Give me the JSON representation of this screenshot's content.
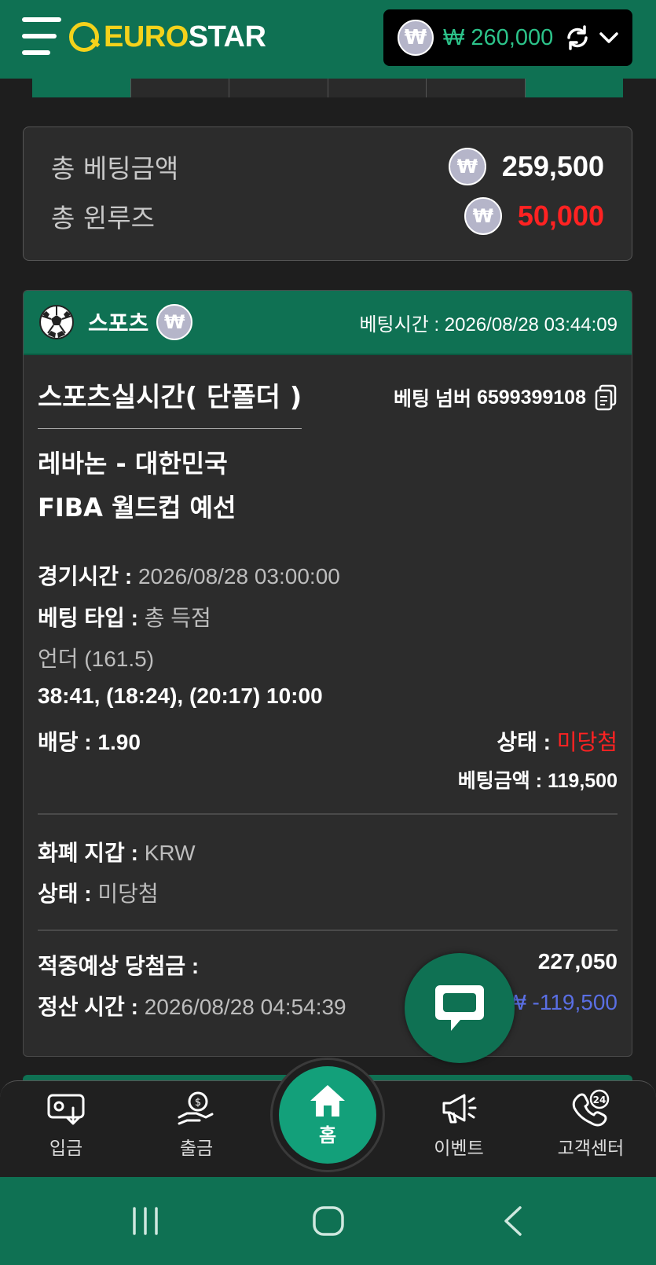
{
  "header": {
    "logo_part1": "EURO",
    "logo_part2": "STAR",
    "currency_symbol": "₩",
    "balance": "₩ 260,000"
  },
  "summary": {
    "total_bet_label": "총 베팅금액",
    "total_bet_value": "259,500",
    "total_winloss_label": "총 윈루즈",
    "total_winloss_value": "50,000"
  },
  "bet_card": {
    "category": "스포츠",
    "bet_time_label": "베팅시간 :",
    "bet_time_value": "2026/08/28 03:44:09",
    "live_title": "스포츠실시간( 단폴더 )",
    "bet_number_label": "베팅 넘버",
    "bet_number": "6599399108",
    "match_teams": "레바논 - 대한민국",
    "league": "FIBA 월드컵 예선",
    "game_time_label": "경기시간 :",
    "game_time_value": "2026/08/28 03:00:00",
    "bet_type_label": "베팅 타입 :",
    "bet_type_value": "총 득점",
    "pick": "언더 (161.5)",
    "score": "38:41, (18:24), (20:17) 10:00",
    "odds_label": "배당 :",
    "odds_value": "1.90",
    "status_label": "상태 :",
    "status_value": "미당첨",
    "bet_amount_label": "베팅금액 :",
    "bet_amount_value": "119,500",
    "wallet_label": "화폐 지갑 :",
    "wallet_value": "KRW",
    "status2_label": "상태 :",
    "status2_value": "미당첨",
    "expected_win_label": "적중예상 당첨금 :",
    "expected_win_value": "227,050",
    "settle_time_label": "정산 시간 :",
    "settle_time_value": "2026/08/28 04:54:39",
    "settle_amount": "₩ -119,500"
  },
  "bottom_nav": {
    "deposit": "입금",
    "withdraw": "출금",
    "home": "홈",
    "event": "이벤트",
    "support": "고객센터",
    "support_badge": "24"
  },
  "colors": {
    "brand_green": "#0f7153",
    "logo_yellow": "#f4d21b",
    "loss_red": "#ff2222",
    "settle_blue": "#5a6fe4"
  }
}
